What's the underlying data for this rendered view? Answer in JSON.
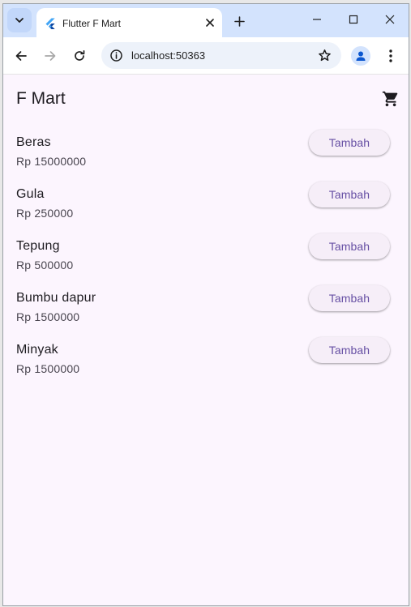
{
  "browser": {
    "tab": {
      "title": "Flutter F Mart",
      "favicon": "flutter-logo"
    },
    "address_bar": {
      "url": "localhost:50363"
    },
    "colors": {
      "tabstrip": "#d3e3fd",
      "toolbar": "#ffffff",
      "omnibox": "#edf2fa"
    }
  },
  "app": {
    "title": "F Mart",
    "cart_icon": "shopping-cart-icon",
    "add_button_label": "Tambah",
    "colors": {
      "background": "#fcf5fe",
      "button_text": "#6750a4",
      "button_bg": "#f6eef8"
    },
    "products": [
      {
        "name": "Beras",
        "price": "Rp 15000000"
      },
      {
        "name": "Gula",
        "price": "Rp 250000"
      },
      {
        "name": "Tepung",
        "price": "Rp 500000"
      },
      {
        "name": "Bumbu dapur",
        "price": "Rp 1500000"
      },
      {
        "name": "Minyak",
        "price": "Rp 1500000"
      }
    ]
  }
}
